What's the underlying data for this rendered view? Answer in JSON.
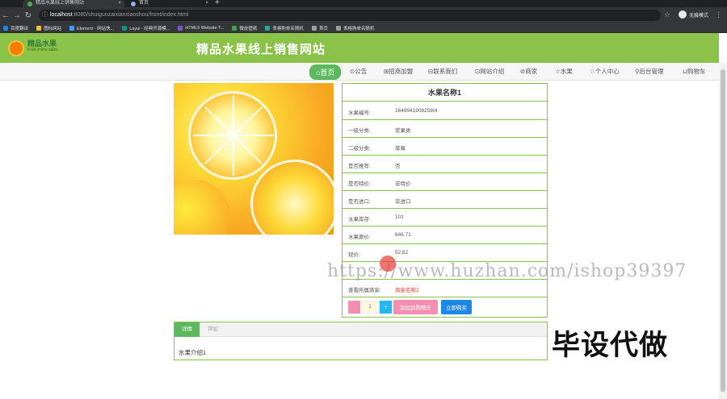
{
  "browser": {
    "tabs": [
      {
        "label": "精品水果线上销售网站",
        "favicon_color": "#4caf50"
      },
      {
        "label": "首页",
        "favicon_color": "#8ab4f8"
      }
    ],
    "new_tab_label": "+",
    "url_host": "localhost",
    "url_rest": ":8080/shuiguozaixianxiaoshou/front/index.html",
    "profile_label": "无痕模式",
    "bookmarks": [
      {
        "label": "百度翻译",
        "color": "#1e88e5"
      },
      {
        "label": "图标网站",
        "color": "#fbc02d"
      },
      {
        "label": "Element - 网站快...",
        "color": "#409eff"
      },
      {
        "label": "Layui - 经典开源模...",
        "color": "#009688"
      },
      {
        "label": "HTML5 Website T...",
        "color": "#7e57c2"
      },
      {
        "label": "微皮壁纸",
        "color": "#43a047"
      },
      {
        "label": "表格购单名随机",
        "color": "#26a69a"
      },
      {
        "label": "首页",
        "color": "#9e9e9e"
      },
      {
        "label": "表格购单名随机",
        "color": "#9e9e9e"
      }
    ]
  },
  "site": {
    "logo_text": "精品水果",
    "logo_sub": "Fruit online sales",
    "title": "精品水果线上销售网站",
    "brand_color": "#8bc34a"
  },
  "nav": {
    "items": [
      {
        "label": "⌂首页",
        "active": true
      },
      {
        "label": "⊙公告"
      },
      {
        "label": "⊞招商加盟"
      },
      {
        "label": "⊟联系我们"
      },
      {
        "label": "⊡网站介绍"
      },
      {
        "label": "⊘商家"
      },
      {
        "label": "☆水果"
      },
      {
        "label": "♘个人中心"
      },
      {
        "label": "⚲后台管理"
      },
      {
        "label": "⊔购物车"
      }
    ]
  },
  "product": {
    "name": "水果名称1",
    "fields": [
      {
        "key": "水果编号:",
        "value": "1649941908258I4"
      },
      {
        "key": "一级分类:",
        "value": "浆果类"
      },
      {
        "key": "二级分类:",
        "value": "草莓"
      },
      {
        "key": "是否推荐:",
        "value": "否"
      },
      {
        "key": "是否特价:",
        "value": "非特价"
      },
      {
        "key": "是否进口:",
        "value": "非进口"
      },
      {
        "key": "水果库存:",
        "value": "101"
      },
      {
        "key": "水果原价:",
        "value": "646.71"
      },
      {
        "key": "现价:",
        "value": "52.62"
      },
      {
        "key": "",
        "value": ""
      },
      {
        "key": "查看所属商家:",
        "value": "商家名称2",
        "highlight": true
      }
    ],
    "quantity": "1",
    "minus_label": "",
    "plus_label": "+",
    "add_to_cart_label": "添加到购物车",
    "buy_now_label": "立即购买"
  },
  "details": {
    "tabs": [
      "详情",
      "评论"
    ],
    "content": "水果介绍1"
  },
  "overlay": {
    "watermark": "https://www.huzhan.com/ishop39397",
    "stamp": "毕设代做"
  }
}
